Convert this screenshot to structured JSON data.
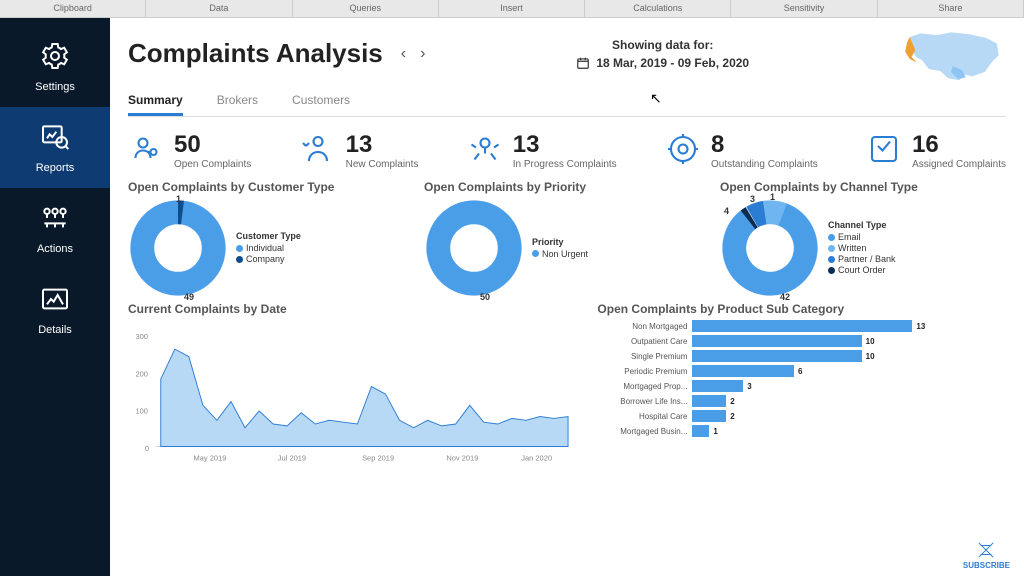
{
  "topbar": [
    "Clipboard",
    "Data",
    "Queries",
    "Insert",
    "Calculations",
    "Sensitivity",
    "Share"
  ],
  "sidebar": [
    {
      "label": "Settings"
    },
    {
      "label": "Reports"
    },
    {
      "label": "Actions"
    },
    {
      "label": "Details"
    }
  ],
  "header": {
    "title": "Complaints Analysis",
    "showing_label": "Showing data for:",
    "date_range": "18 Mar, 2019 - 09 Feb, 2020"
  },
  "tabs": [
    "Summary",
    "Brokers",
    "Customers"
  ],
  "kpis": [
    {
      "value": "50",
      "label": "Open Complaints"
    },
    {
      "value": "13",
      "label": "New Complaints"
    },
    {
      "value": "13",
      "label": "In Progress Complaints"
    },
    {
      "value": "8",
      "label": "Outstanding Complaints"
    },
    {
      "value": "16",
      "label": "Assigned Complaints"
    }
  ],
  "donut_titles": {
    "customer": "Open Complaints by Customer Type",
    "priority": "Open Complaints by Priority",
    "channel": "Open Complaints by Channel Type"
  },
  "legends": {
    "customer_title": "Customer Type",
    "priority_title": "Priority",
    "channel_title": "Channel Type",
    "individual": "Individual",
    "company": "Company",
    "non_urgent": "Non Urgent",
    "email": "Email",
    "written": "Written",
    "partner": "Partner / Bank",
    "court": "Court Order"
  },
  "callouts": {
    "cust_1": "1",
    "cust_49": "49",
    "pri_50": "50",
    "ch_1": "1",
    "ch_3": "3",
    "ch_4": "4",
    "ch_42": "42"
  },
  "area_title": "Current Complaints by Date",
  "bar_title": "Open Complaints by Product Sub Category",
  "bar_categories": [
    "Non Mortgaged",
    "Outpatient Care",
    "Single Premium",
    "Periodic Premium",
    "Mortgaged Prop...",
    "Borrower Life Ins...",
    "Hospital Care",
    "Mortgaged Busin..."
  ],
  "bar_values": [
    "13",
    "10",
    "10",
    "6",
    "3",
    "2",
    "2",
    "1"
  ],
  "subscribe_label": "SUBSCRIBE",
  "chart_data": [
    {
      "type": "pie",
      "title": "Open Complaints by Customer Type",
      "series": [
        {
          "name": "Individual",
          "value": 49,
          "color": "#4a9ee8"
        },
        {
          "name": "Company",
          "value": 1,
          "color": "#0d4d8c"
        }
      ]
    },
    {
      "type": "pie",
      "title": "Open Complaints by Priority",
      "series": [
        {
          "name": "Non Urgent",
          "value": 50,
          "color": "#4a9ee8"
        }
      ]
    },
    {
      "type": "pie",
      "title": "Open Complaints by Channel Type",
      "series": [
        {
          "name": "Email",
          "value": 42,
          "color": "#4a9ee8"
        },
        {
          "name": "Written",
          "value": 4,
          "color": "#6fb5ef"
        },
        {
          "name": "Partner / Bank",
          "value": 3,
          "color": "#2b7cd3"
        },
        {
          "name": "Court Order",
          "value": 1,
          "color": "#0a2d52"
        }
      ]
    },
    {
      "type": "area",
      "title": "Current Complaints by Date",
      "xlabel": "",
      "ylabel": "",
      "ylim": [
        0,
        300
      ],
      "x": [
        "May 2019",
        "Jul 2019",
        "Sep 2019",
        "Nov 2019",
        "Jan 2020"
      ],
      "values": [
        180,
        260,
        240,
        110,
        70,
        120,
        50,
        95,
        60,
        55,
        90,
        60,
        70,
        65,
        60,
        160,
        140,
        70,
        50,
        70,
        55,
        60,
        110,
        65,
        60,
        75,
        70,
        80,
        75,
        80
      ]
    },
    {
      "type": "bar",
      "title": "Open Complaints by Product Sub Category",
      "categories": [
        "Non Mortgaged",
        "Outpatient Care",
        "Single Premium",
        "Periodic Premium",
        "Mortgaged Prop...",
        "Borrower Life Ins...",
        "Hospital Care",
        "Mortgaged Busin..."
      ],
      "values": [
        13,
        10,
        10,
        6,
        3,
        2,
        2,
        1
      ]
    }
  ]
}
